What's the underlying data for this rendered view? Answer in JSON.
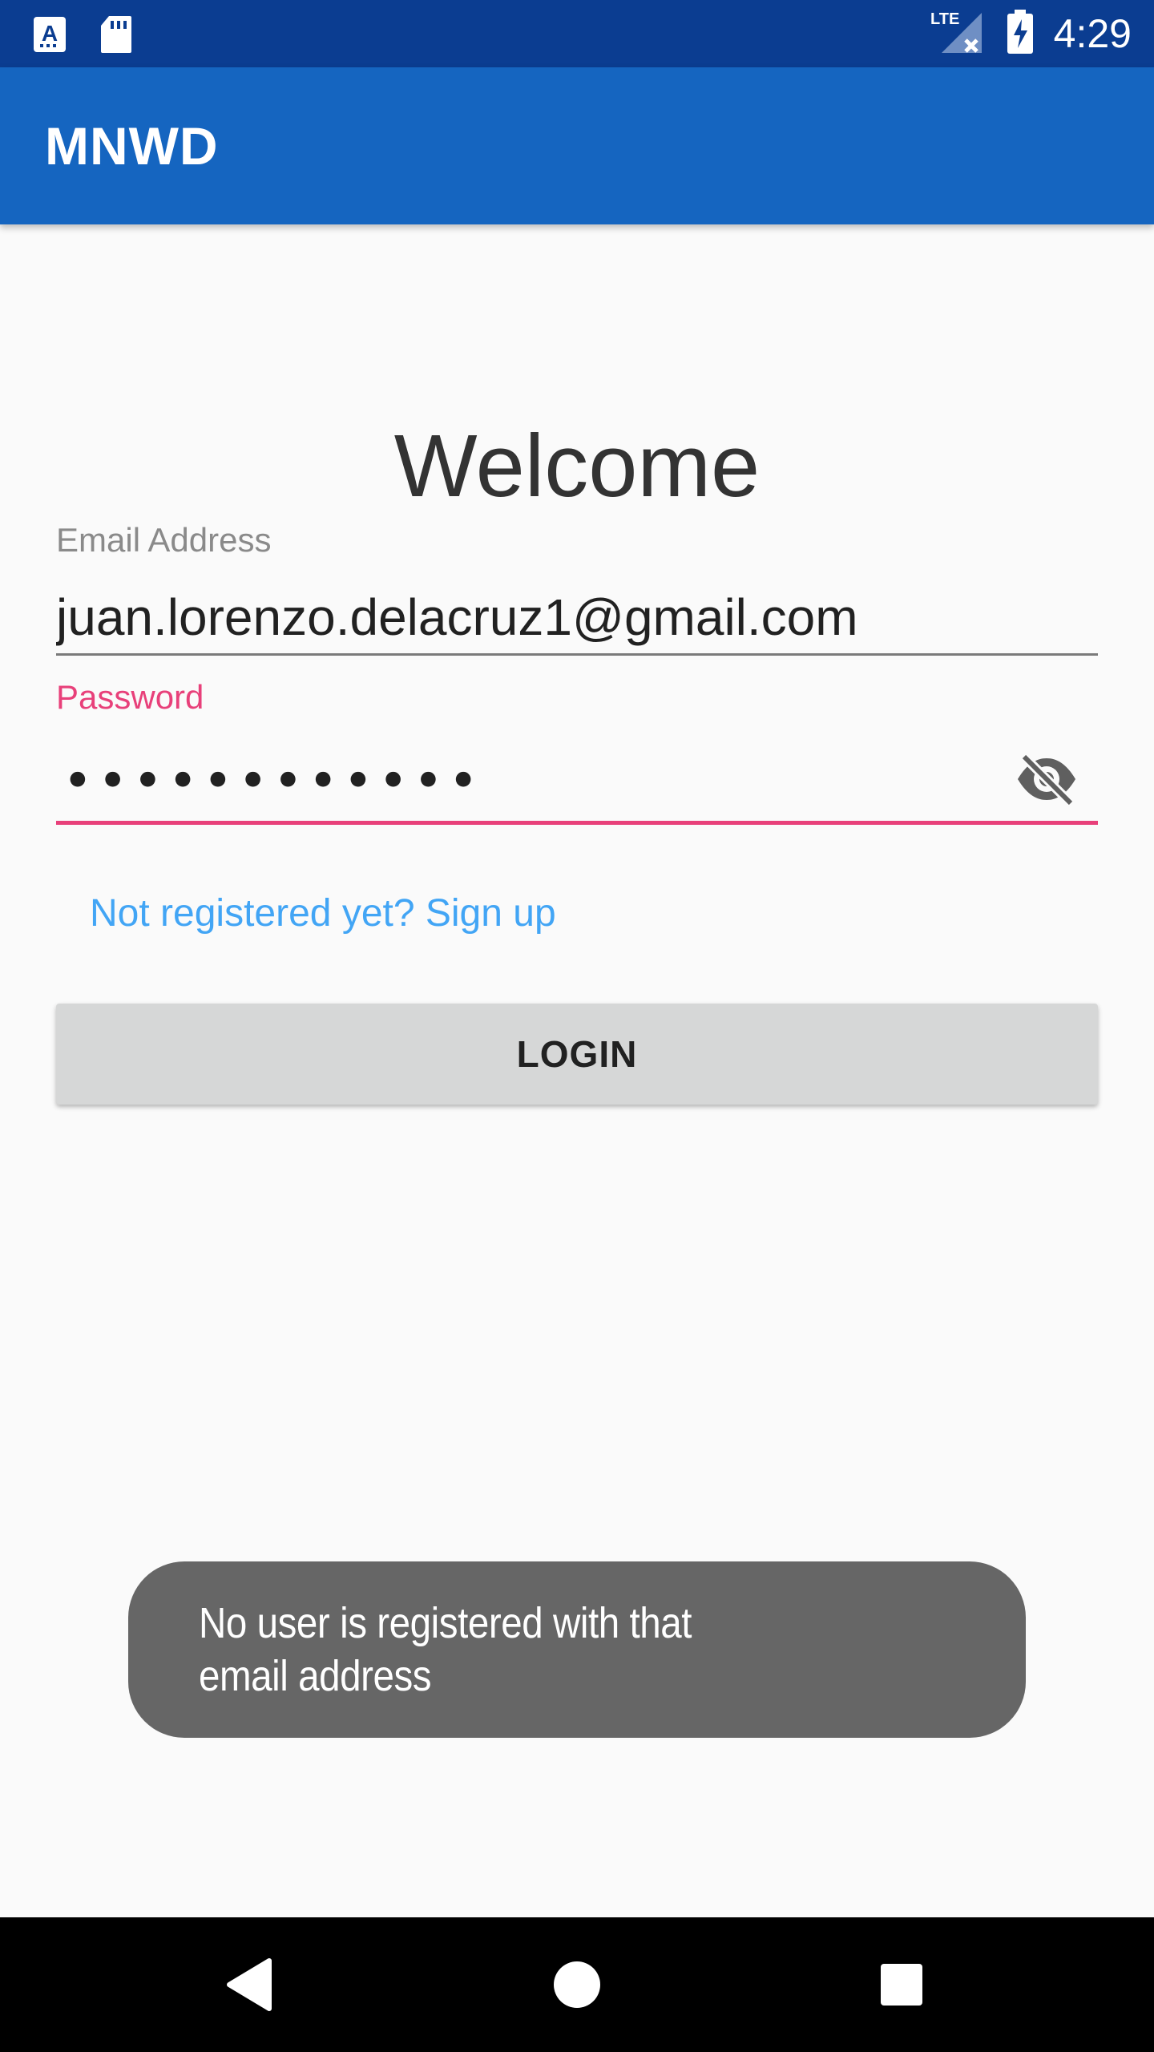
{
  "status_bar": {
    "time": "4:29",
    "network": "LTE",
    "icons": [
      "text-a-notification-icon",
      "sd-card-icon",
      "lte-signal-icon",
      "battery-charging-icon"
    ]
  },
  "app_bar": {
    "title": "MNWD",
    "color": "#1565c0"
  },
  "login_form": {
    "heading": "Welcome",
    "email": {
      "label": "Email Address",
      "value": "juan.lorenzo.delacruz1@gmail.com"
    },
    "password": {
      "label": "Password",
      "masked_value": "••••••••••••",
      "visibility_icon": "visibility-off-icon",
      "accent": "#e8407a"
    },
    "signup_link": "Not registered yet? Sign up",
    "login_button": "LOGIN"
  },
  "toast": {
    "message_line1": "No user is registered with that",
    "message_line2": "email address"
  },
  "nav_bar": {
    "buttons": [
      "back-icon",
      "home-icon",
      "recents-icon"
    ]
  }
}
